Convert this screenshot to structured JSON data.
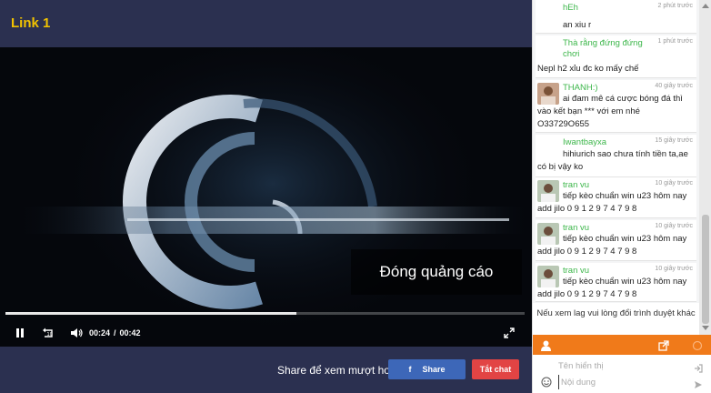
{
  "page": {
    "title": "Link 1"
  },
  "player": {
    "ad_close_label": "Đóng quảng cáo",
    "current_time": "00:24",
    "time_separator": "/",
    "duration": "00:42",
    "progress_fraction": 0.56
  },
  "share": {
    "prompt": "Share để xem mượt hơn",
    "fb_icon_text": "f",
    "share_label": "Share",
    "hide_chat_label": "Tắt chat"
  },
  "chat": {
    "messages": [
      {
        "name": "hEh",
        "time": "2 phút trước",
        "text": "an xiu r",
        "has_avatar": false
      },
      {
        "name": "Thà rằng đứng đứng chơi",
        "time": "1 phút trước",
        "text": "Nepl h2 xỉu đc ko mấy chế",
        "has_avatar": false
      },
      {
        "name": "THANH:)",
        "time": "40 giây trước",
        "text": "ai đam mê cá cược bóng đá thì vào kết bạn *** với em nhé O33729O655",
        "has_avatar": true
      },
      {
        "name": "Iwantbayxa",
        "time": "15 giây trước",
        "text": "hihiurich sao chưa tính tiền ta,ae có bị vậy ko",
        "has_avatar": false
      },
      {
        "name": "tran vu",
        "time": "10 giây trước",
        "text": "tiếp kèo chuẩn win u23 hôm nay add jilo 0 9 1 2 9 7 4 7 9 8",
        "has_avatar": true
      },
      {
        "name": "tran vu",
        "time": "10 giây trước",
        "text": "tiếp kèo chuẩn win u23 hôm nay add jilo 0 9 1 2 9 7 4 7 9 8",
        "has_avatar": true
      },
      {
        "name": "tran vu",
        "time": "10 giây trước",
        "text": "tiếp kèo chuẩn win u23 hôm nay add jilo 0 9 1 2 9 7 4 7 9 8",
        "has_avatar": true
      }
    ],
    "notice": "Nếu xem lag vui lòng đổi trình duyệt khác",
    "name_placeholder": "Tên hiển thị",
    "content_placeholder": "Nội dung"
  },
  "colors": {
    "title": "#f2c300",
    "chat_toolbar": "#f07a1a",
    "share_button": "#3d67b8",
    "hide_chat_button": "#e24444",
    "username": "#3cb64a"
  }
}
